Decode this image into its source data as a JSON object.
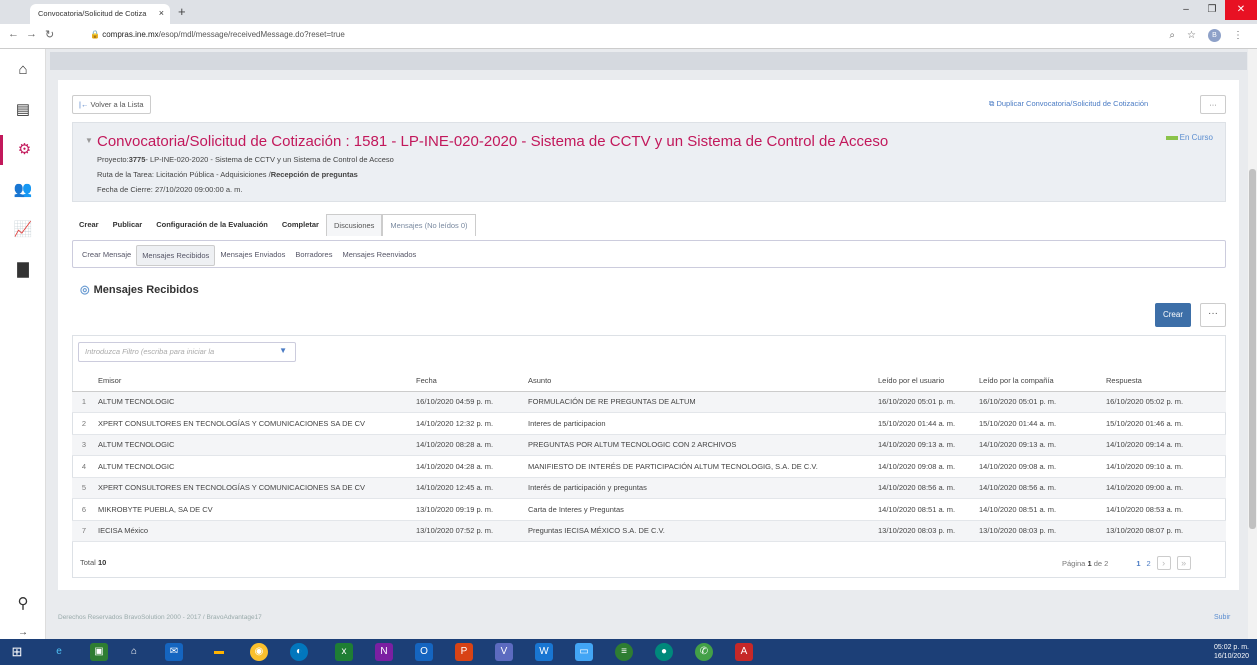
{
  "browser": {
    "tab_title": "Convocatoria/Solicitud de Cotiza",
    "tab_close": "×",
    "new_tab": "+",
    "url_host": "compras.ine.mx",
    "url_path": "/esop/mdl/message/receivedMessage.do?reset=true",
    "avatar_letter": "B"
  },
  "actions": {
    "back": "Volver a la Lista",
    "duplicate": "Duplicar Convocatoria/Solicitud de Cotización",
    "more": "···"
  },
  "header": {
    "title": "Convocatoria/Solicitud de Cotización : 1581 - LP-INE-020-2020 - Sistema de CCTV y un Sistema de Control de Acceso",
    "status": "En Curso",
    "project_label": "Proyecto:",
    "project_code": "3775",
    "project_rest": "- LP-INE-020-2020 - Sistema de CCTV y un Sistema de Control de Acceso",
    "route_label": "Ruta de la Tarea: Licitación Pública - Adquisiciones /",
    "route_bold": "Recepción de preguntas",
    "closing": "Fecha de Cierre: 27/10/2020 09:00:00 a. m."
  },
  "main_tabs": [
    "Crear",
    "Publicar",
    "Configuración de la Evaluación",
    "Completar",
    "Discusiones",
    "Mensajes (No leídos 0)"
  ],
  "sub_tabs": [
    "Crear Mensaje",
    "Mensajes Recibidos",
    "Mensajes Enviados",
    "Borradores",
    "Mensajes Reenviados"
  ],
  "section": {
    "title": "Mensajes Recibidos",
    "create_button": "Crear",
    "more": "···"
  },
  "filter": {
    "placeholder": "Introduzca Filtro (escriba para iniciar la"
  },
  "table": {
    "columns": [
      "Emisor",
      "Fecha",
      "Asunto",
      "Leído por el usuario",
      "Leído por la compañía",
      "Respuesta"
    ],
    "rows": [
      {
        "n": "1",
        "emisor": "ALTUM TECNOLOGIC",
        "fecha": "16/10/2020 04:59 p. m.",
        "asunto": "FORMULACIÓN DE RE PREGUNTAS DE ALTUM",
        "leido_usuario": "16/10/2020 05:01 p. m.",
        "leido_compania": "16/10/2020 05:01 p. m.",
        "respuesta": "16/10/2020 05:02 p. m."
      },
      {
        "n": "2",
        "emisor": "XPERT CONSULTORES EN TECNOLOGÍAS Y COMUNICACIONES SA DE CV",
        "fecha": "14/10/2020 12:32 p. m.",
        "asunto": "Interes de participacion",
        "leido_usuario": "15/10/2020 01:44 a. m.",
        "leido_compania": "15/10/2020 01:44 a. m.",
        "respuesta": "15/10/2020 01:46 a. m."
      },
      {
        "n": "3",
        "emisor": "ALTUM TECNOLOGIC",
        "fecha": "14/10/2020 08:28 a. m.",
        "asunto": "PREGUNTAS POR ALTUM TECNOLOGIC CON 2 ARCHIVOS",
        "leido_usuario": "14/10/2020 09:13 a. m.",
        "leido_compania": "14/10/2020 09:13 a. m.",
        "respuesta": "14/10/2020 09:14 a. m."
      },
      {
        "n": "4",
        "emisor": "ALTUM TECNOLOGIC",
        "fecha": "14/10/2020 04:28 a. m.",
        "asunto": "MANIFIESTO DE INTERÉS DE PARTICIPACIÓN ALTUM TECNOLOGIG, S.A. DE C.V.",
        "leido_usuario": "14/10/2020 09:08 a. m.",
        "leido_compania": "14/10/2020 09:08 a. m.",
        "respuesta": "14/10/2020 09:10 a. m."
      },
      {
        "n": "5",
        "emisor": "XPERT CONSULTORES EN TECNOLOGÍAS Y COMUNICACIONES SA DE CV",
        "fecha": "14/10/2020 12:45 a. m.",
        "asunto": "Interés de participación y preguntas",
        "leido_usuario": "14/10/2020 08:56 a. m.",
        "leido_compania": "14/10/2020 08:56 a. m.",
        "respuesta": "14/10/2020 09:00 a. m."
      },
      {
        "n": "6",
        "emisor": "MIKROBYTE PUEBLA, SA DE CV",
        "fecha": "13/10/2020 09:19 p. m.",
        "asunto": "Carta de Interes y Preguntas",
        "leido_usuario": "14/10/2020 08:51 a. m.",
        "leido_compania": "14/10/2020 08:51 a. m.",
        "respuesta": "14/10/2020 08:53 a. m."
      },
      {
        "n": "7",
        "emisor": "IECISA México",
        "fecha": "13/10/2020 07:52 p. m.",
        "asunto": "Preguntas IECISA MÉXICO S.A. DE C.V.",
        "leido_usuario": "13/10/2020 08:03 p. m.",
        "leido_compania": "13/10/2020 08:03 p. m.",
        "respuesta": "13/10/2020 08:07 p. m."
      }
    ]
  },
  "pagination": {
    "total_label": "Total",
    "total": "10",
    "page_label": "Página",
    "current": "1",
    "of_label": "de 2",
    "pages": [
      "1",
      "2"
    ]
  },
  "footer": {
    "copyright": "Derechos Reservados BravoSolution 2000 - 2017 / BravoAdvantage17",
    "top_link": "Subir"
  },
  "taskbar": {
    "time": "05:02 p. m.",
    "date": "16/10/2020"
  },
  "colors": {
    "accent": "#c2185b",
    "link": "#4a7bc4",
    "primary_button": "#3d6fa8",
    "status_green": "#8bc34a"
  }
}
